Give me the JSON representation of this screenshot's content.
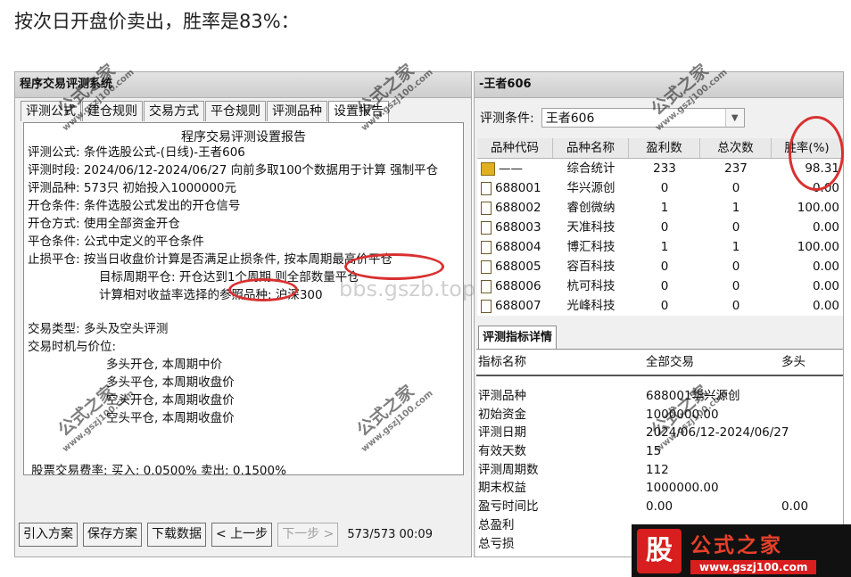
{
  "heading": "按次日开盘价卖出，胜率是83%：",
  "left_window": {
    "title": "程序交易评测系统",
    "tabs": [
      "评测公式",
      "建仓规则",
      "交易方式",
      "平仓规则",
      "评测品种",
      "设置报告"
    ],
    "active_tab": 5,
    "report_title": "程序交易评测设置报告",
    "report_lines": [
      "评测公式: 条件选股公式-(日线)-王者606",
      "评测时段: 2024/06/12-2024/06/27 向前多取100个数据用于计算 强制平仓",
      "评测品种: 573只 初始投入1000000元",
      "开仓条件: 条件选股公式发出的开仓信号",
      "开仓方式: 使用全部资金开仓",
      "平仓条件: 公式中定义的平仓条件",
      "止损平仓: 按当日收盘价计算是否满足止损条件, 按本周期最高价平仓"
    ],
    "report_sub_lines": [
      "目标周期平仓: 开仓达到1个周期 则全部数量平仓",
      "计算相对收益率选择的参照品种: 沪深300"
    ],
    "trade_type": "交易类型: 多头及空头评测",
    "trade_timing": "交易时机与价位:",
    "trade_rules": [
      "多头开仓, 本周期中价",
      "多头平仓, 本周期收盘价",
      "空头开仓, 本周期收盘价",
      "空头平仓, 本周期收盘价"
    ],
    "fee_line": "股票交易费率: 买入: 0.0500%  卖出: 0.1500%",
    "buttons": {
      "import": "引入方案",
      "save": "保存方案",
      "download": "下载数据",
      "prev": "< 上一步",
      "next": "下一步 >"
    },
    "progress": "573/573 00:09"
  },
  "right_window": {
    "title": "-王者606",
    "filter_label": "评测条件:",
    "filter_value": "王者606",
    "columns": [
      "品种代码",
      "品种名称",
      "盈利数",
      "总次数",
      "胜率(%)"
    ],
    "rows": [
      {
        "code": "——",
        "name": "综合统计",
        "wins": "233",
        "total": "237",
        "rate": "98.31"
      },
      {
        "code": "688001",
        "name": "华兴源创",
        "wins": "0",
        "total": "0",
        "rate": "0.00"
      },
      {
        "code": "688002",
        "name": "睿创微纳",
        "wins": "1",
        "total": "1",
        "rate": "100.00"
      },
      {
        "code": "688003",
        "name": "天准科技",
        "wins": "0",
        "total": "0",
        "rate": "0.00"
      },
      {
        "code": "688004",
        "name": "博汇科技",
        "wins": "1",
        "total": "1",
        "rate": "100.00"
      },
      {
        "code": "688005",
        "name": "容百科技",
        "wins": "0",
        "total": "0",
        "rate": "0.00"
      },
      {
        "code": "688006",
        "name": "杭可科技",
        "wins": "0",
        "total": "0",
        "rate": "0.00"
      },
      {
        "code": "688007",
        "name": "光峰科技",
        "wins": "0",
        "total": "0",
        "rate": "0.00"
      }
    ],
    "detail_tab": "评测指标详情",
    "detail_header": [
      "指标名称",
      "全部交易",
      "多头"
    ],
    "detail_rows": [
      {
        "name": "评测品种",
        "all": "688001华兴源创",
        "long": ""
      },
      {
        "name": "初始资金",
        "all": "1000000.00",
        "long": ""
      },
      {
        "name": "评测日期",
        "all": "2024/06/12-2024/06/27",
        "long": ""
      },
      {
        "name": "有效天数",
        "all": "15",
        "long": ""
      },
      {
        "name": "评测周期数",
        "all": "112",
        "long": ""
      },
      {
        "name": "期末权益",
        "all": "1000000.00",
        "long": ""
      },
      {
        "name": "盈亏时间比",
        "all": "0.00",
        "long": "0.00"
      },
      {
        "name": "总盈利",
        "all": "",
        "long": ""
      },
      {
        "name": "总亏损",
        "all": "",
        "long": ""
      }
    ]
  },
  "watermark": {
    "text": "公式之家",
    "url": "www.gszj100.com",
    "center": "bbs.gszb.top"
  },
  "logo": {
    "seal": "股",
    "name": "公式之家",
    "url": "www.gszj100.com"
  },
  "colors": {
    "annotation": "#d93030",
    "logo_red": "#d81e1e"
  }
}
